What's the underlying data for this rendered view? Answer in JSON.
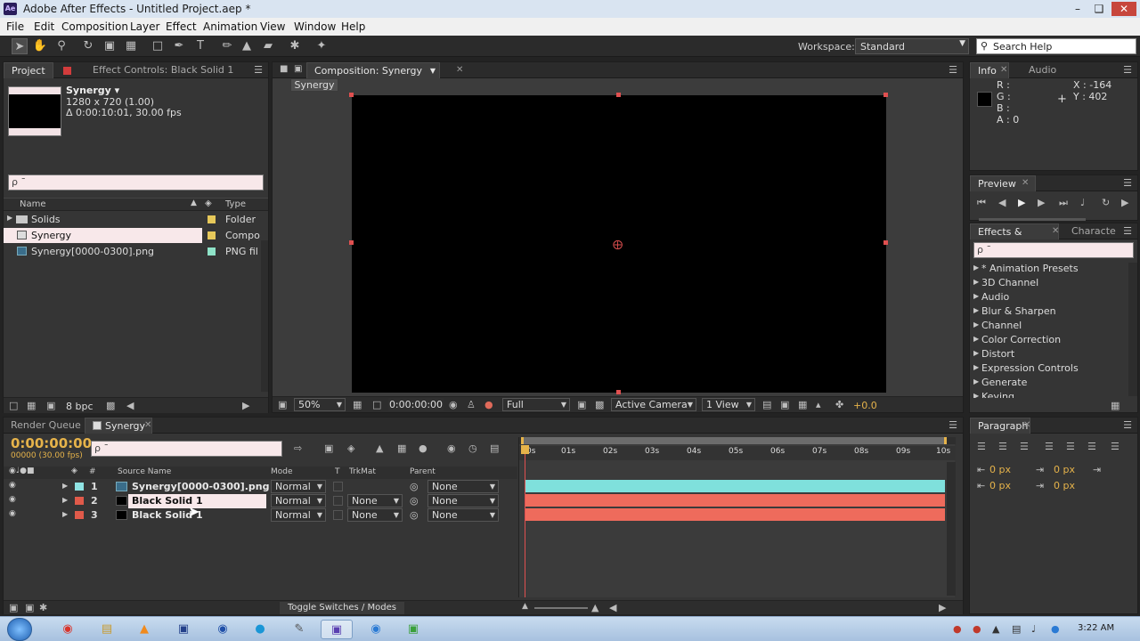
{
  "window": {
    "title": "Adobe After Effects - Untitled Project.aep *",
    "app_icon": "Ae"
  },
  "menu": [
    "File",
    "Edit",
    "Composition",
    "Layer",
    "Effect",
    "Animation",
    "View",
    "Window",
    "Help"
  ],
  "workspace": {
    "label": "Workspace:",
    "value": "Standard"
  },
  "search_help": {
    "placeholder": "Search Help"
  },
  "project_panel": {
    "tabs": [
      "Project",
      "Effect Controls: Black Solid 1"
    ],
    "comp_name": "Synergy ▾",
    "comp_size": "1280 x 720 (1.00)",
    "comp_duration": "Δ 0:00:10:01, 30.00 fps",
    "search_placeholder": "ρ ˉ",
    "columns": {
      "name": "Name",
      "type": "Type"
    },
    "items": [
      {
        "name": "Solids",
        "type": "Folder",
        "icon": "folder-icon",
        "label_color": "#e6c85a"
      },
      {
        "name": "Synergy",
        "type": "Compo",
        "icon": "composition-icon",
        "label_color": "#e6c85a"
      },
      {
        "name": "Synergy[0000-0300].png",
        "type": "PNG fil",
        "icon": "image-sequence-icon",
        "label_color": "#8fe3c8"
      }
    ],
    "bpc": "8 bpc"
  },
  "composition_panel": {
    "tab": "Composition: Synergy",
    "breadcrumb": "Synergy",
    "zoom": "50%",
    "timecode": "0:00:00:00",
    "resolution": "Full",
    "camera": "Active Camera",
    "views": "1 View",
    "exposure": "+0.0"
  },
  "info_panel": {
    "tabs": [
      "Info",
      "Audio"
    ],
    "r": "R :",
    "g": "G :",
    "b": "B :",
    "a": "A : 0",
    "x": "X : -164",
    "y": "Y : 402"
  },
  "preview_panel": {
    "tab": "Preview"
  },
  "effects_panel": {
    "tabs": [
      "Effects & Presets",
      "Characte"
    ],
    "search_placeholder": "ρ ˉ",
    "items": [
      "* Animation Presets",
      "3D Channel",
      "Audio",
      "Blur & Sharpen",
      "Channel",
      "Color Correction",
      "Distort",
      "Expression Controls",
      "Generate",
      "Keying"
    ]
  },
  "paragraph_panel": {
    "tab": "Paragraph",
    "indent_left": "0 px",
    "indent_right": "0 px",
    "indent_first": "0 px",
    "space_before": "0 px",
    "space_after": "0 px"
  },
  "timeline": {
    "tabs": [
      "Render Queue",
      "Synergy"
    ],
    "timecode": "0:00:00:00",
    "fps": "00000 (30.00 fps)",
    "search_placeholder": "ρ ˉ",
    "columns": {
      "source_name": "Source Name",
      "mode": "Mode",
      "t": "T",
      "trkmat": "TrkMat",
      "parent": "Parent"
    },
    "layers": [
      {
        "num": "1",
        "name": "Synergy[0000-0300].png",
        "mode": "Normal",
        "trkmat": "",
        "parent": "None",
        "label_color": "#8fe3e3",
        "bar_color": "#7fe0dc"
      },
      {
        "num": "2",
        "name": "Black Solid 1",
        "mode": "Normal",
        "trkmat": "None",
        "parent": "None",
        "label_color": "#e05a4a",
        "bar_color": "#ee6b5c"
      },
      {
        "num": "3",
        "name": "Black Solid 1",
        "mode": "Normal",
        "trkmat": "None",
        "parent": "None",
        "label_color": "#e05a4a",
        "bar_color": "#ee6b5c"
      }
    ],
    "ruler": [
      "0s",
      "01s",
      "02s",
      "03s",
      "04s",
      "05s",
      "06s",
      "07s",
      "08s",
      "09s",
      "10s"
    ],
    "toggle_label": "Toggle Switches / Modes"
  },
  "taskbar": {
    "apps": [
      "start-orb",
      "chrome-icon",
      "explorer-icon",
      "vlc-icon",
      "photoshop-icon",
      "firefox-icon",
      "skype-icon",
      "paint-icon",
      "after-effects-icon",
      "ie-icon",
      "misc-app-icon"
    ],
    "clock": "3:22 AM"
  }
}
